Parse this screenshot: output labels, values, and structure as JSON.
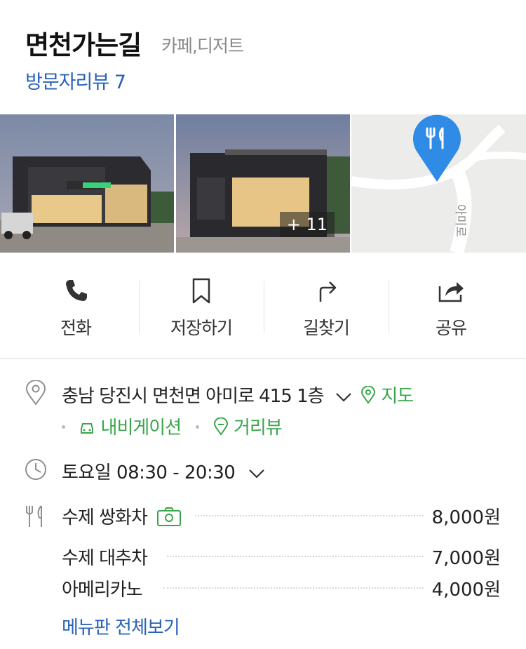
{
  "place": {
    "name": "면천가는길",
    "category": "카페,디저트",
    "reviews": "방문자리뷰 7"
  },
  "photos": {
    "more_count": "+ 11"
  },
  "map": {
    "road_label": "아미로"
  },
  "actions": [
    {
      "label": "전화",
      "icon": "phone-icon"
    },
    {
      "label": "저장하기",
      "icon": "bookmark-icon"
    },
    {
      "label": "길찾기",
      "icon": "directions-icon"
    },
    {
      "label": "공유",
      "icon": "share-icon"
    }
  ],
  "address": {
    "text": "충남 당진시 면천면 아미로 415 1층",
    "map_link": "지도",
    "navigation": "내비게이션",
    "street_view": "거리뷰"
  },
  "hours": {
    "text": "토요일 08:30 - 20:30"
  },
  "menu": {
    "items": [
      {
        "name": "수제 쌍화차",
        "price": "8,000원",
        "has_photo": true
      },
      {
        "name": "수제 대추차",
        "price": "7,000원"
      },
      {
        "name": "아메리카노",
        "price": "4,000원"
      }
    ],
    "see_all": "메뉴판 전체보기"
  },
  "colors": {
    "link_blue": "#2962b8",
    "green": "#3aa64b",
    "pin_blue": "#2f8be6"
  }
}
